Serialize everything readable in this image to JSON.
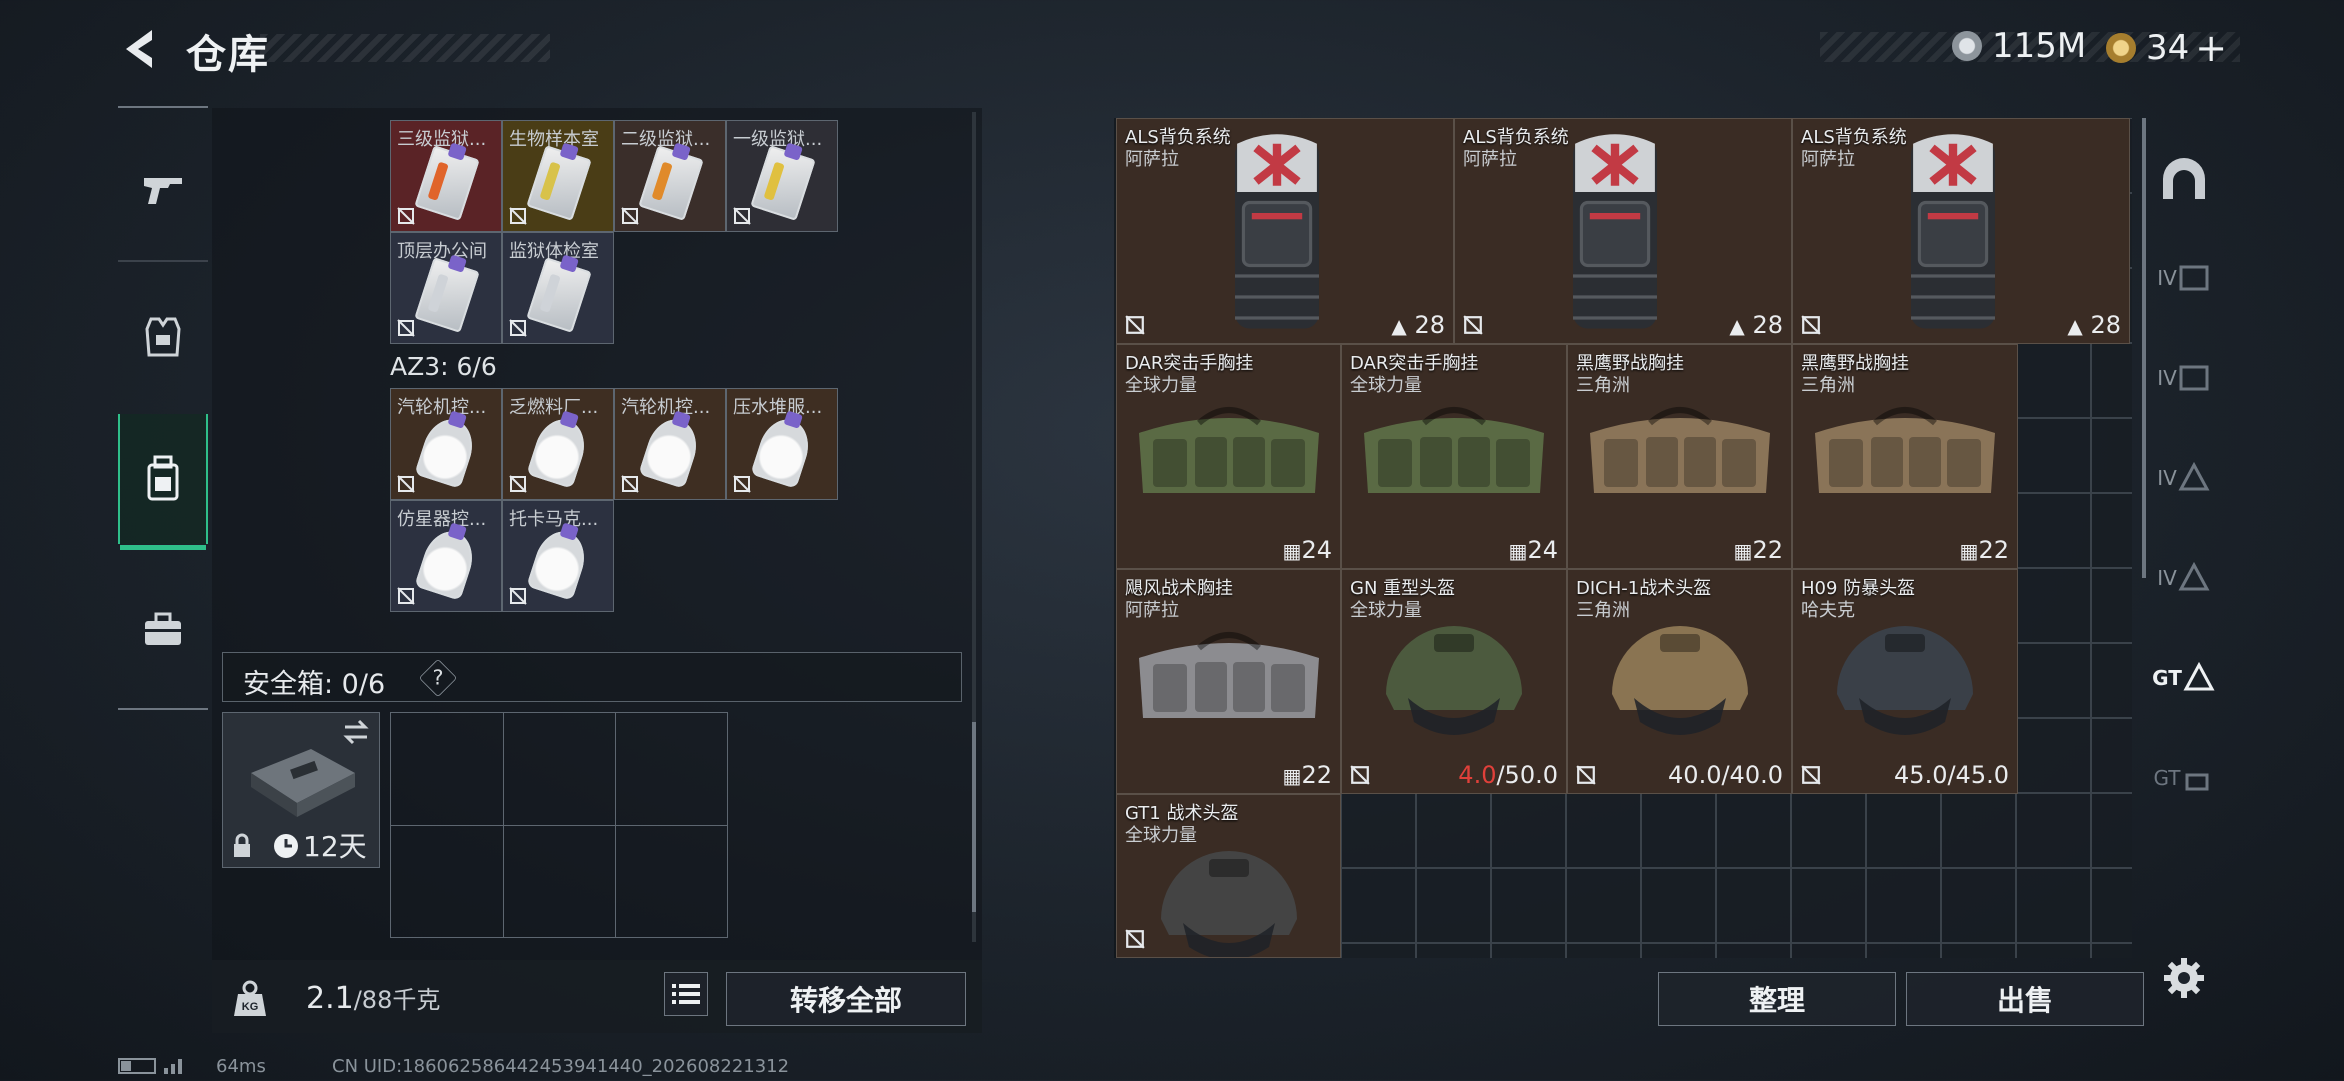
{
  "header": {
    "title": "仓库"
  },
  "currency": [
    {
      "value": "115M",
      "icon": "silver-coin-icon",
      "color": "#b8c0c8"
    },
    {
      "value": "34",
      "icon": "gold-coin-icon",
      "color": "#c9a14a",
      "plus": "+"
    }
  ],
  "nav": [
    {
      "name": "weapon",
      "icon": "gun-icon",
      "active": false
    },
    {
      "name": "armor",
      "icon": "vest-icon",
      "active": false
    },
    {
      "name": "backpack",
      "icon": "backpack-icon",
      "active": true
    },
    {
      "name": "case",
      "icon": "briefcase-icon",
      "active": false
    }
  ],
  "keycards_top": [
    {
      "label": "三级监狱...",
      "bg": "#5a2326",
      "stripe": "#e0642a"
    },
    {
      "label": "生物样本室",
      "bg": "#4a3d16",
      "stripe": "#d8c24a"
    },
    {
      "label": "二级监狱...",
      "bg": "#3a2e2a",
      "stripe": "#e08a2a"
    },
    {
      "label": "一级监狱...",
      "bg": "#2e2e35",
      "stripe": "#e0c040"
    },
    {
      "label": "顶层办公间",
      "bg": "#2c3140",
      "stripe": "#cfd3d8"
    },
    {
      "label": "监狱体检室",
      "bg": "#2c3140",
      "stripe": "#cfd3d8"
    }
  ],
  "az3": {
    "label": "AZ3: 6/6"
  },
  "keycards_az3": [
    {
      "label": "汽轮机控...",
      "bg": "#3e2e22"
    },
    {
      "label": "乏燃料厂...",
      "bg": "#3e2e22"
    },
    {
      "label": "汽轮机控...",
      "bg": "#3e2e22"
    },
    {
      "label": "压水堆服...",
      "bg": "#3e2e22"
    },
    {
      "label": "仿星器控...",
      "bg": "#2c3140"
    },
    {
      "label": "托卡马克...",
      "bg": "#2c3140"
    }
  ],
  "safe_box": {
    "label": "安全箱: 0/6",
    "help": "?",
    "duration": "12天"
  },
  "weight": {
    "current": "2.1",
    "max": "/88千克"
  },
  "buttons": {
    "transfer_all": "转移全部",
    "sort": "整理",
    "sell": "出售"
  },
  "items": [
    {
      "name": "ALS背负系统",
      "brand": "阿萨拉",
      "value": "28",
      "kind": "backpack"
    },
    {
      "name": "ALS背负系统",
      "brand": "阿萨拉",
      "value": "28",
      "kind": "backpack"
    },
    {
      "name": "ALS背负系统",
      "brand": "阿萨拉",
      "value": "28",
      "kind": "backpack"
    },
    {
      "name": "DAR突击手胸挂",
      "brand": "全球力量",
      "value": "24",
      "kind": "rig",
      "color": "#5a6a44"
    },
    {
      "name": "DAR突击手胸挂",
      "brand": "全球力量",
      "value": "24",
      "kind": "rig",
      "color": "#5a6a44"
    },
    {
      "name": "黑鹰野战胸挂",
      "brand": "三角洲",
      "value": "22",
      "kind": "rig",
      "color": "#8a7458"
    },
    {
      "name": "黑鹰野战胸挂",
      "brand": "三角洲",
      "value": "22",
      "kind": "rig",
      "color": "#8a7458"
    },
    {
      "name": "飓风战术胸挂",
      "brand": "阿萨拉",
      "value": "22",
      "kind": "rig",
      "color": "#8c8c90"
    },
    {
      "name": "GN 重型头盔",
      "brand": "全球力量",
      "durability_current": "4.0",
      "durability_max": "/50.0",
      "kind": "helmet",
      "color": "#4c5a3e"
    },
    {
      "name": "DICH-1战术头盔",
      "brand": "三角洲",
      "durability_current": "40.0",
      "durability_max": "/40.0",
      "kind": "helmet",
      "color": "#8a7452"
    },
    {
      "name": "H09 防暴头盔",
      "brand": "哈夫克",
      "durability_current": "45.0",
      "durability_max": "/45.0",
      "kind": "helmet",
      "color": "#3a4048"
    },
    {
      "name": "GT1 战术头盔",
      "brand": "全球力量",
      "kind": "helmet"
    }
  ],
  "right_side": [
    {
      "icon": "helmet-slot-icon"
    },
    {
      "icon": "armor-iv-icon",
      "tier": "IV"
    },
    {
      "icon": "armor-iv-icon-2",
      "tier": "IV"
    },
    {
      "icon": "rig-iv-icon",
      "tier": "IV"
    },
    {
      "icon": "rig-iv-icon-2",
      "tier": "IV"
    },
    {
      "icon": "rig-gt-icon",
      "tier": "GT"
    },
    {
      "icon": "gt-slot-icon",
      "tier": "GT"
    }
  ],
  "status": {
    "ping": "64ms",
    "uid": "CN UID:1860625864424539414​40_202608221312"
  }
}
